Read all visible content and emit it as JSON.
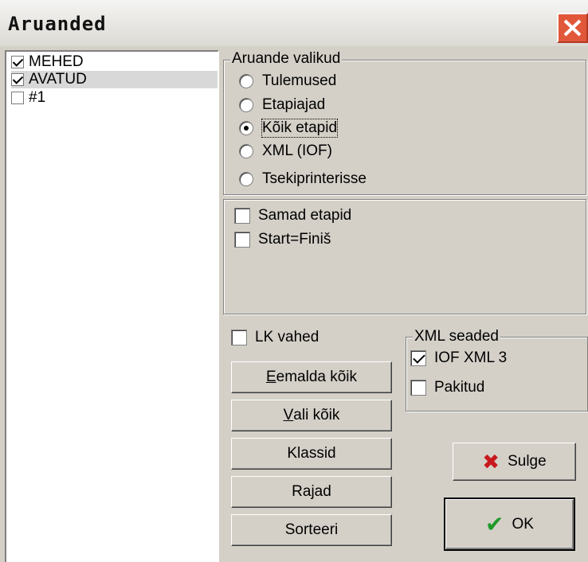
{
  "window": {
    "title": "Aruanded"
  },
  "list": {
    "items": [
      {
        "label": "MEHED",
        "checked": true
      },
      {
        "label": "AVATUD",
        "checked": true,
        "selected": true
      },
      {
        "label": "#1",
        "checked": false
      }
    ]
  },
  "report_options": {
    "legend": "Aruande valikud",
    "options": [
      {
        "label": "Tulemused",
        "selected": false
      },
      {
        "label": "Etapiajad",
        "selected": false
      },
      {
        "label": "Kõik etapid",
        "selected": true
      },
      {
        "label": "XML (IOF)",
        "selected": false
      },
      {
        "label": "Tsekiprinterisse",
        "selected": false
      }
    ]
  },
  "extra": {
    "same_stages": {
      "label": "Samad etapid",
      "checked": false
    },
    "start_finish": {
      "label": "Start=Finiš",
      "checked": false
    }
  },
  "page_breaks": {
    "label": "LK vahed",
    "checked": false
  },
  "xml_settings": {
    "legend": "XML seaded",
    "iof_xml3": {
      "label": "IOF XML 3",
      "checked": true
    },
    "packed": {
      "label": "Pakitud",
      "checked": false
    }
  },
  "buttons": {
    "remove_all_first": "E",
    "remove_all_rest": "emalda kõik",
    "select_all_first": "V",
    "select_all_rest": "ali kõik",
    "classes": "Klassid",
    "courses": "Rajad",
    "sort": "Sorteeri",
    "close": "Sulge",
    "ok": "OK"
  }
}
